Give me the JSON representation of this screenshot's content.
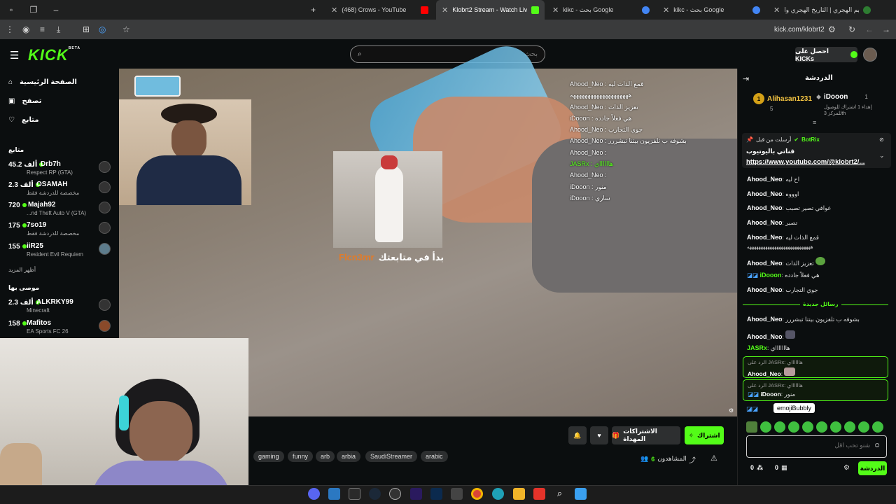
{
  "browser": {
    "tabs": [
      {
        "label": "(468) Crows - YouTube",
        "color": "#ff0000"
      },
      {
        "label": "Klobrt2 Stream - Watch Liv",
        "color": "#53fc18",
        "active": true
      },
      {
        "label": "kikc - بحث Google",
        "color": "#4285f4"
      },
      {
        "label": "kikc - بحث Google",
        "color": "#4285f4"
      },
      {
        "label": "التقويم الهجري | التاريخ الهجري وا",
        "color": "#2e7d32"
      }
    ],
    "url": "kick.com/klobrt2"
  },
  "header": {
    "logo": "KICK",
    "logo_badge": "BETA",
    "search_placeholder": "بحث",
    "get_kicks": "احصل على KICKs"
  },
  "sidebar": {
    "nav": [
      {
        "label": "الصفحة الرئيسية",
        "icon": "home-icon"
      },
      {
        "label": "تصفح",
        "icon": "browse-icon"
      },
      {
        "label": "متابع",
        "icon": "heart-icon"
      }
    ],
    "following_title": "متابع",
    "following": [
      {
        "count": "45.2 ألف",
        "name": "Drb7h",
        "category": "Respect RP (GTA)"
      },
      {
        "count": "2.3 ألف",
        "name": "OSAMAH",
        "category": "مخصصة للدردشة فقط"
      },
      {
        "count": "720",
        "name": "Majah92",
        "category": "...nd Theft Auto V (GTA)"
      },
      {
        "count": "175",
        "name": "7so19",
        "category": "مخصصة للدردشة فقط"
      },
      {
        "count": "155",
        "name": "iiR25",
        "category": "Resident Evil Requiem"
      }
    ],
    "show_more": "أظهر المزيد",
    "recommended_title": "موصى بها",
    "recommended": [
      {
        "count": "2.3 ألف",
        "name": "ALKRKY99",
        "category": "Minecraft"
      },
      {
        "count": "158",
        "name": "Mafitos",
        "category": "EA Sports FC 26"
      }
    ]
  },
  "video": {
    "follow_text": "بدأ في متابعتك",
    "follower_name": "Flcn3mr",
    "overlay_chat": [
      "Ahood_Neo : قمع الذات ليه",
      "ههههههههههههههههههههه",
      "Ahood_Neo : تعزيز الذات",
      "iDooon : هي فعلاً جادده",
      "Ahood_Neo : جوي التجارب",
      "Ahood_Neo : بشوفه ب تلفزيون بيتنا تبشررر",
      "Ahood_Neo :",
      "JASRx : هااااااي",
      "Ahood_Neo :",
      "iDooon : منور",
      "iDooon : ساري"
    ]
  },
  "stream": {
    "subscribe": "اشتراك",
    "gift_subs": "الاشتراكات المهداة",
    "tags": [
      "gaming",
      "funny",
      "arb",
      "arbia",
      "SaudiStreamer",
      "arabic"
    ],
    "viewers_count": "6",
    "viewers_label": "المشاهدون"
  },
  "chat": {
    "title": "الدردشة",
    "leaderboard": [
      {
        "rank": "1",
        "name": "iDooon",
        "count": "1",
        "sub": "إهداء 1 اشتراك للوصول",
        "sub2": "للمركز 3th"
      },
      {
        "rank": "1",
        "name": "Alihasan1231",
        "count": "5"
      }
    ],
    "pinned": {
      "by_label": "أرسلت من قبل",
      "author": "BotRix",
      "title": "قناتي باليوتيوب",
      "link": "https://www.youtube.com/@klobrt2/..."
    },
    "messages": [
      {
        "user": "Ahood_Neo",
        "text": "اح ليه"
      },
      {
        "user": "Ahood_Neo",
        "text": "اوووه"
      },
      {
        "user": "Ahood_Neo",
        "text": "عوافي تصير تصبب"
      },
      {
        "user": "Ahood_Neo",
        "text": "تصبر"
      },
      {
        "user": "Ahood_Neo",
        "text": "قمع الذات ليه"
      },
      {
        "user": "",
        "text": "ههههههههههههههههههههههههههههه"
      },
      {
        "user": "Ahood_Neo",
        "text": "تعزيز الذات"
      },
      {
        "user": "iDooon",
        "text": "هي فعلاً جادده"
      },
      {
        "user": "Ahood_Neo",
        "text": "جوي التجارب"
      }
    ],
    "new_messages": "رسائل جديدة",
    "messages2": [
      {
        "user": "Ahood_Neo",
        "text": "بشوفه ب تلفزيون بيتنا تبشررر"
      },
      {
        "user": "Ahood_Neo",
        "text": ""
      },
      {
        "user": "JASRx",
        "text": "هاااااااي"
      }
    ],
    "replies": [
      {
        "reply_to": "الرد على JASRx: هااااااي",
        "user": "Ahood_Neo",
        "text": ""
      },
      {
        "reply_to": "الرد على JASRx: هااااااي",
        "user": "iDooon",
        "text": "منور"
      }
    ],
    "tooltip": "emojiBubbly",
    "input_placeholder": "شنو تحب اقل",
    "chat_button": "الدردشة",
    "points_a": "0",
    "points_b": "0"
  },
  "taskbar": {
    "apps": [
      "discord",
      "defender",
      "epic",
      "steam",
      "chatgpt",
      "premiere",
      "photoshop",
      "store",
      "chrome",
      "edge",
      "explorer",
      "anydesk",
      "search",
      "start"
    ]
  }
}
